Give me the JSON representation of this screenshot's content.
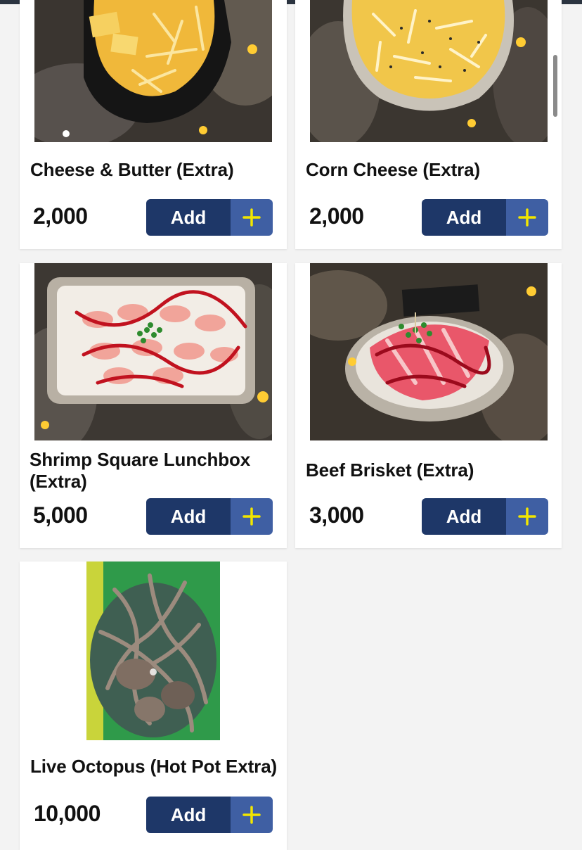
{
  "items": [
    {
      "name": "Cheese & Butter (Extra)",
      "price": "2,000",
      "button_label": "Add"
    },
    {
      "name": "Corn Cheese (Extra)",
      "price": "2,000",
      "button_label": "Add"
    },
    {
      "name": "Shrimp Square Lunchbox (Extra)",
      "price": "5,000",
      "button_label": "Add"
    },
    {
      "name": "Beef Brisket (Extra)",
      "price": "3,000",
      "button_label": "Add"
    },
    {
      "name": "Live Octopus (Hot Pot Extra)",
      "price": "10,000",
      "button_label": "Add"
    }
  ],
  "colors": {
    "button_primary": "#1e3768",
    "button_secondary": "#3f5fa3",
    "plus_icon": "#f2e600",
    "page_background": "#f3f3f3"
  },
  "icons": {
    "add": "plus-icon"
  }
}
